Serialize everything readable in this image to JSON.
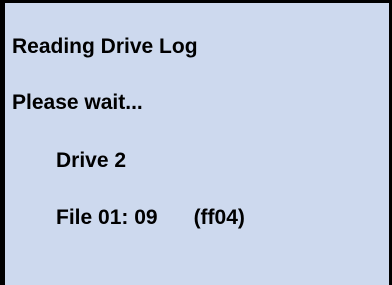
{
  "screen": {
    "background_color": "#cdd9ee",
    "border_color": "#000000",
    "text_color": "#000000",
    "title": "Reading Drive Log",
    "status": "Please wait...",
    "drive": "Drive 2",
    "file_progress": "File 01: 09",
    "file_code": "(ff04)"
  }
}
